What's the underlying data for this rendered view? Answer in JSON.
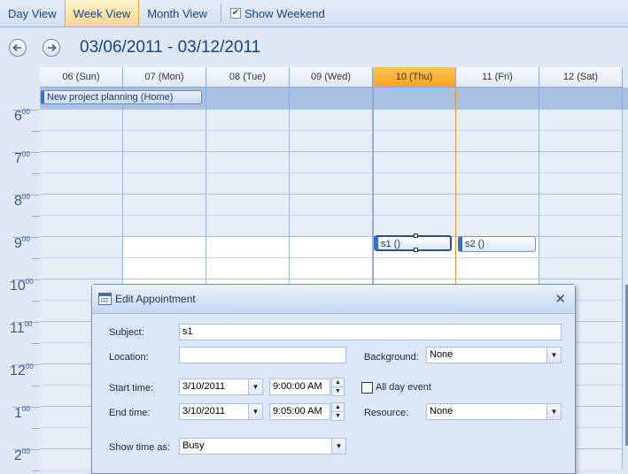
{
  "toolbar": {
    "day_view": "Day View",
    "week_view": "Week View",
    "month_view": "Month View",
    "show_weekend": "Show Weekend",
    "show_weekend_checked": true
  },
  "nav": {
    "prev_icon": "arrow-left-circle-icon",
    "next_icon": "arrow-right-circle-icon",
    "date_range": "03/06/2011 - 03/12/2011"
  },
  "calendar": {
    "days": [
      "06 (Sun)",
      "07 (Mon)",
      "08 (Tue)",
      "09 (Wed)",
      "10 (Thu)",
      "11 (Fri)",
      "12 (Sat)"
    ],
    "today_index": 4,
    "hours": [
      {
        "h": "6",
        "m": "00"
      },
      {
        "h": "7",
        "m": "00"
      },
      {
        "h": "8",
        "m": "00"
      },
      {
        "h": "9",
        "m": "00"
      },
      {
        "h": "10",
        "m": "00"
      },
      {
        "h": "11",
        "m": "00"
      },
      {
        "h": "12",
        "m": "00"
      },
      {
        "h": "1",
        "m": "00"
      },
      {
        "h": "2",
        "m": "00"
      }
    ],
    "all_day_appointment": "New project planning (Home)",
    "appointments": {
      "s1": "s1 ()",
      "s2": "s2 ()"
    },
    "colors": {
      "accent": "#3a6fc4",
      "today_header": "#f7a41c",
      "today_border": "#e09a3a"
    }
  },
  "dialog": {
    "title": "Edit Appointment",
    "close_icon": "close-icon",
    "subject_label": "Subject:",
    "subject_value": "s1",
    "location_label": "Location:",
    "location_value": "",
    "background_label": "Background:",
    "background_value": "None",
    "start_label": "Start time:",
    "start_date": "3/10/2011",
    "start_time": "9:00:00 AM",
    "all_day_label": "All day event",
    "all_day_checked": false,
    "end_label": "End time:",
    "end_date": "3/10/2011",
    "end_time": "9:05:00 AM",
    "resource_label": "Resource:",
    "resource_value": "None",
    "show_as_label": "Show time as:",
    "show_as_value": "Busy"
  }
}
